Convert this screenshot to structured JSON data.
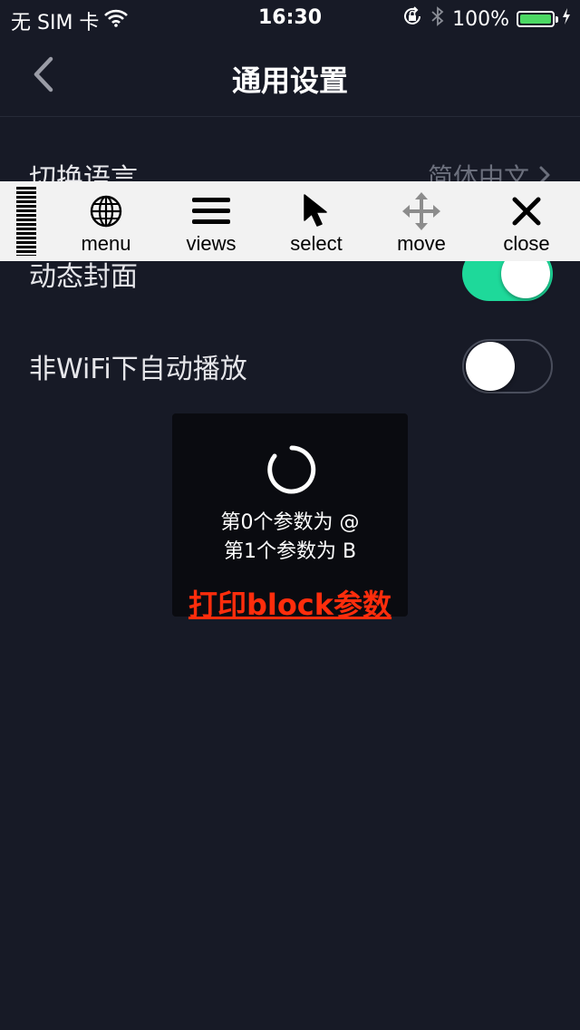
{
  "status_bar": {
    "carrier": "无 SIM 卡",
    "time": "16:30",
    "battery_percent": "100%",
    "battery_level": 1.0,
    "icons": [
      "wifi-icon",
      "orientation-lock-icon",
      "bluetooth-icon",
      "battery-icon",
      "charging-icon"
    ],
    "battery_color": "#4cd964"
  },
  "nav": {
    "title": "通用设置",
    "back_icon": "chevron-left-icon"
  },
  "settings": {
    "language": {
      "label": "切换语言",
      "value": "简体中文"
    },
    "dynamic_cover": {
      "label": "动态封面",
      "enabled": true
    },
    "autoplay_non_wifi": {
      "label": "非WiFi下自动播放",
      "enabled": false
    }
  },
  "debug_toolbar": {
    "items": [
      {
        "label": "menu",
        "icon": "globe-icon"
      },
      {
        "label": "views",
        "icon": "hamburger-icon"
      },
      {
        "label": "select",
        "icon": "cursor-arrow-icon"
      },
      {
        "label": "move",
        "icon": "move-arrows-icon"
      },
      {
        "label": "close",
        "icon": "close-icon"
      }
    ]
  },
  "hud": {
    "line1": "第0个参数为 @",
    "line2": "第1个参数为 B",
    "link": "打印block参数",
    "link_color": "#ff2d0c"
  },
  "colors": {
    "background": "#171a26",
    "toggle_on": "#1ed99a",
    "toolbar_bg": "#f2f2f2"
  }
}
